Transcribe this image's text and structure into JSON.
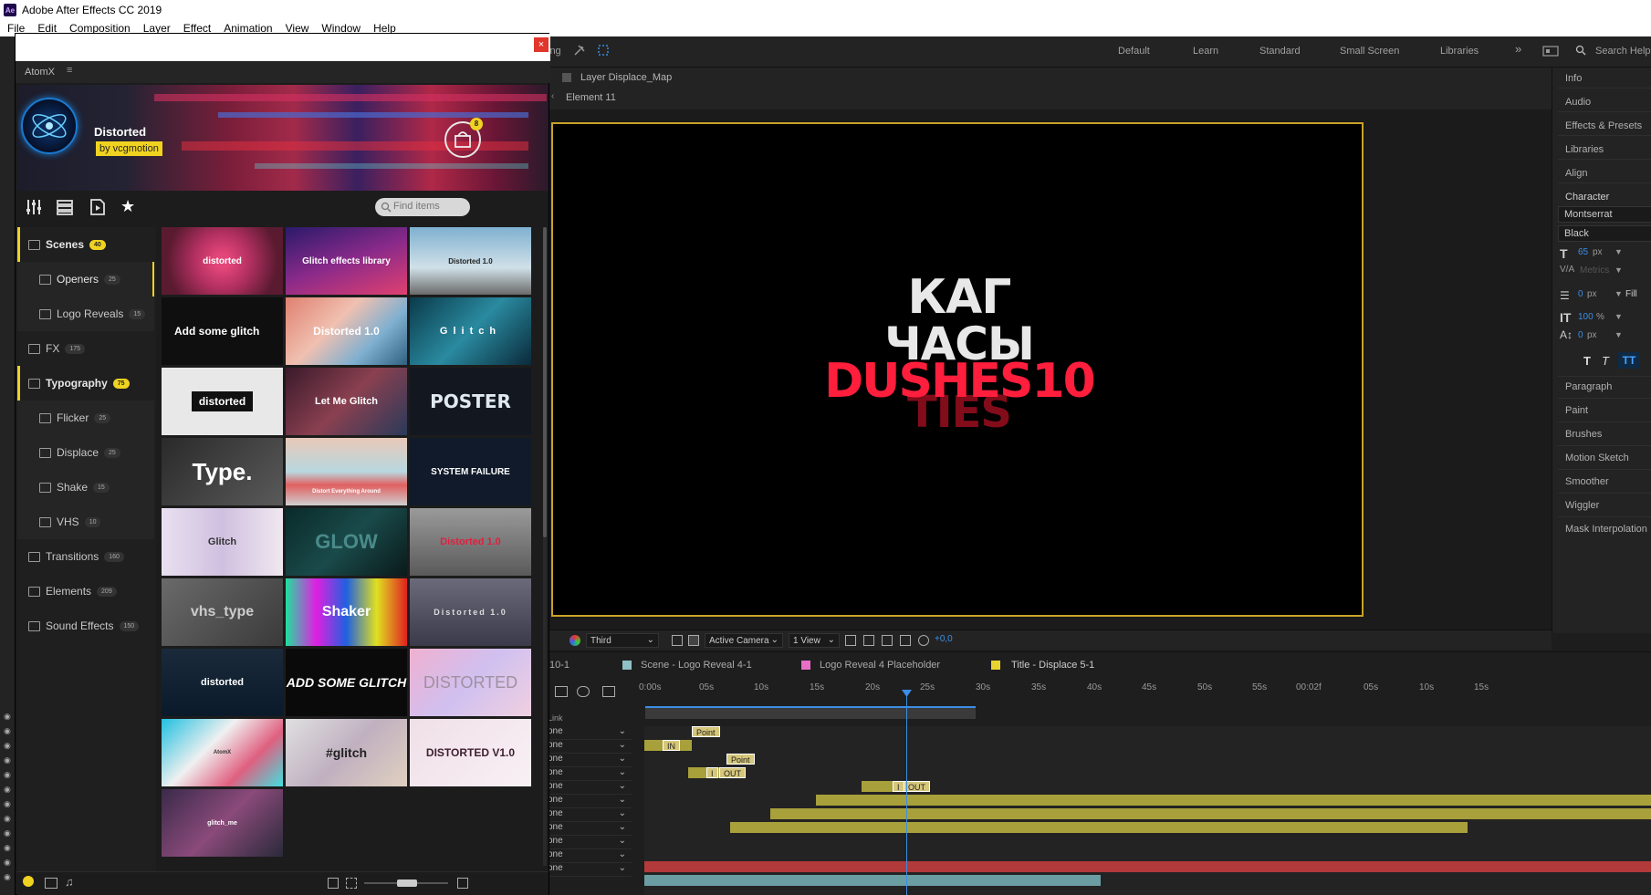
{
  "app": {
    "title": "Adobe After Effects CC 2019",
    "icon": "Ae",
    "menu": [
      "File",
      "Edit",
      "Composition",
      "Layer",
      "Effect",
      "Animation",
      "View",
      "Window",
      "Help"
    ]
  },
  "workspaces": {
    "items": [
      "Default",
      "Learn",
      "Standard",
      "Small Screen",
      "Libraries"
    ],
    "overflow": "»",
    "search_label": "Search Help",
    "truncated_left": "ing"
  },
  "viewer": {
    "layer_label": "Layer Displace_Map",
    "breadcrumb": "Element 11",
    "comp_text": {
      "line1": "КАГ",
      "line2": "ЧАСЫ",
      "line3": "DUSHES10",
      "line4": "TIES"
    },
    "tools": {
      "camera_view": "Third",
      "active_camera": "Active Camera",
      "views": "1 View",
      "exposure": "+0,0"
    }
  },
  "right_panel": {
    "items": [
      "Info",
      "Audio",
      "Effects & Presets",
      "Libraries",
      "Align",
      "Character"
    ],
    "font_family": "Montserrat",
    "font_style": "Black",
    "font_size": "65",
    "font_size_unit": "px",
    "kerning": "Metrics",
    "leading": "0",
    "leading_unit": "px",
    "fill_label": "Fill",
    "vertical_scale": "100",
    "vertical_scale_unit": "%",
    "baseline_shift": "0",
    "baseline_unit": "px",
    "items_lower": [
      "Paragraph",
      "Paint",
      "Brushes",
      "Motion Sketch",
      "Smoother",
      "Wiggler",
      "Mask Interpolation"
    ]
  },
  "timeline": {
    "tabs": [
      {
        "label": "10-1",
        "color": ""
      },
      {
        "label": "Scene - Logo Reveal 4-1",
        "color": "#8fc1c6"
      },
      {
        "label": "Logo Reveal 4 Placeholder",
        "color": "#e86fc8"
      },
      {
        "label": "Title - Displace 5-1",
        "color": "#e8d232"
      }
    ],
    "link_label": "Link",
    "ruler": [
      "0:00s",
      "05s",
      "10s",
      "15s",
      "20s",
      "25s",
      "30s",
      "35s",
      "40s",
      "45s",
      "50s",
      "55s",
      "00:02f",
      "05s",
      "10s",
      "15s"
    ],
    "row_mode": "one",
    "keys": [
      "Point",
      "IN",
      "Point",
      "OUT",
      "OUT"
    ],
    "key_prefixes": [
      "",
      "",
      "",
      "I",
      "I"
    ]
  },
  "atomx": {
    "panel_title": "AtomX",
    "pack_name": "Distorted",
    "author": "by vcgmotion",
    "cart_count": "8",
    "search_placeholder": "Find items",
    "categories": [
      {
        "label": "Scenes",
        "count": "40",
        "bold": true
      },
      {
        "label": "Openers",
        "count": "25"
      },
      {
        "label": "Logo Reveals",
        "count": "15"
      },
      {
        "label": "FX",
        "count": "175"
      },
      {
        "label": "Typography",
        "count": "75",
        "bold": true
      },
      {
        "label": "Flicker",
        "count": "25"
      },
      {
        "label": "Displace",
        "count": "25"
      },
      {
        "label": "Shake",
        "count": "15"
      },
      {
        "label": "VHS",
        "count": "10"
      },
      {
        "label": "Transitions",
        "count": "160"
      },
      {
        "label": "Elements",
        "count": "209"
      },
      {
        "label": "Sound Effects",
        "count": "150"
      }
    ],
    "tiles": [
      "distorted",
      "Glitch effects library",
      "Distorted 1.0",
      "Add some glitch",
      "Distorted 1.0",
      "Glitch",
      "distorted",
      "Let Me Glitch",
      "POSTER",
      "Type.",
      "Distort Everything Around",
      "SYSTEM FAILURE",
      "Glitch",
      "GLOW",
      "Distorted 1.0",
      "vhs_type",
      "Shaker",
      "Distorted 1.0",
      "distorted",
      "ADD SOME GLITCH",
      "DISTORTED",
      "AtomX",
      "#glitch",
      "DISTORTED V1.0",
      "glitch_me"
    ]
  }
}
